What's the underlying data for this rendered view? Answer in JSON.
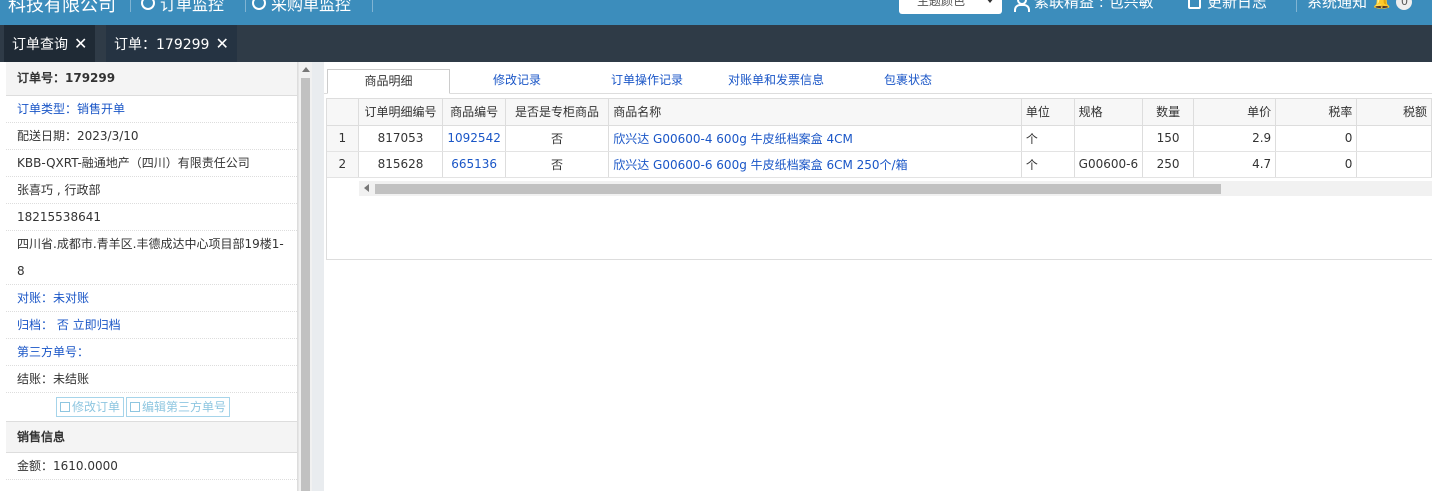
{
  "topbar": {
    "company": "科技有限公司",
    "nav_items": [
      "订单监控",
      "采购单监控"
    ],
    "theme_label": "主题颜色",
    "user_label": "紫联精益 : 包兴敏",
    "update_log": "更新日志",
    "notification_label": "系统通知",
    "notification_count": "0"
  },
  "tabs": [
    {
      "label": "订单查询"
    },
    {
      "label": "订单：179299"
    }
  ],
  "order": {
    "order_no": "订单号：179299",
    "type": "订单类型：销售开单",
    "delivery_date": "配送日期：2023/3/10",
    "customer": "KBB-QXRT-融通地产（四川）有限责任公司",
    "contact": "张喜巧 , 行政部",
    "phone": "18215538641",
    "address": "四川省.成都市.青羊区.丰德成达中心项目部19楼1-8",
    "reconcile": "对账：未对账",
    "archive": "归档：  否 立即归档",
    "third_party": "第三方单号：",
    "settle": "结账：未结账",
    "edit_order_btn": "修改订单",
    "edit_third_btn": "编辑第三方单号"
  },
  "sales": {
    "title": "销售信息",
    "amount": "金额：1610.0000"
  },
  "main_tabs": [
    "商品明细",
    "修改记录",
    "订单操作记录",
    "对账单和发票信息",
    "包裹状态"
  ],
  "table": {
    "columns": [
      "",
      "订单明细编号",
      "商品编号",
      "是否是专柜商品",
      "商品名称",
      "单位",
      "规格",
      "数量",
      "单价",
      "税率",
      "税额"
    ],
    "rows": [
      {
        "rn": "1",
        "detail_no": "817053",
        "sku": "1092542",
        "special": "否",
        "name": "欣兴达 G00600-4 600g 牛皮纸档案盒 4CM",
        "unit": "个",
        "spec": "",
        "qty": "150",
        "price": "2.9",
        "tax_rate": "0",
        "tax": ""
      },
      {
        "rn": "2",
        "detail_no": "815628",
        "sku": "665136",
        "special": "否",
        "name": "欣兴达 G00600-6 600g 牛皮纸档案盒 6CM 250个/箱",
        "unit": "个",
        "spec": "G00600-6",
        "qty": "250",
        "price": "4.7",
        "tax_rate": "0",
        "tax": ""
      }
    ]
  }
}
